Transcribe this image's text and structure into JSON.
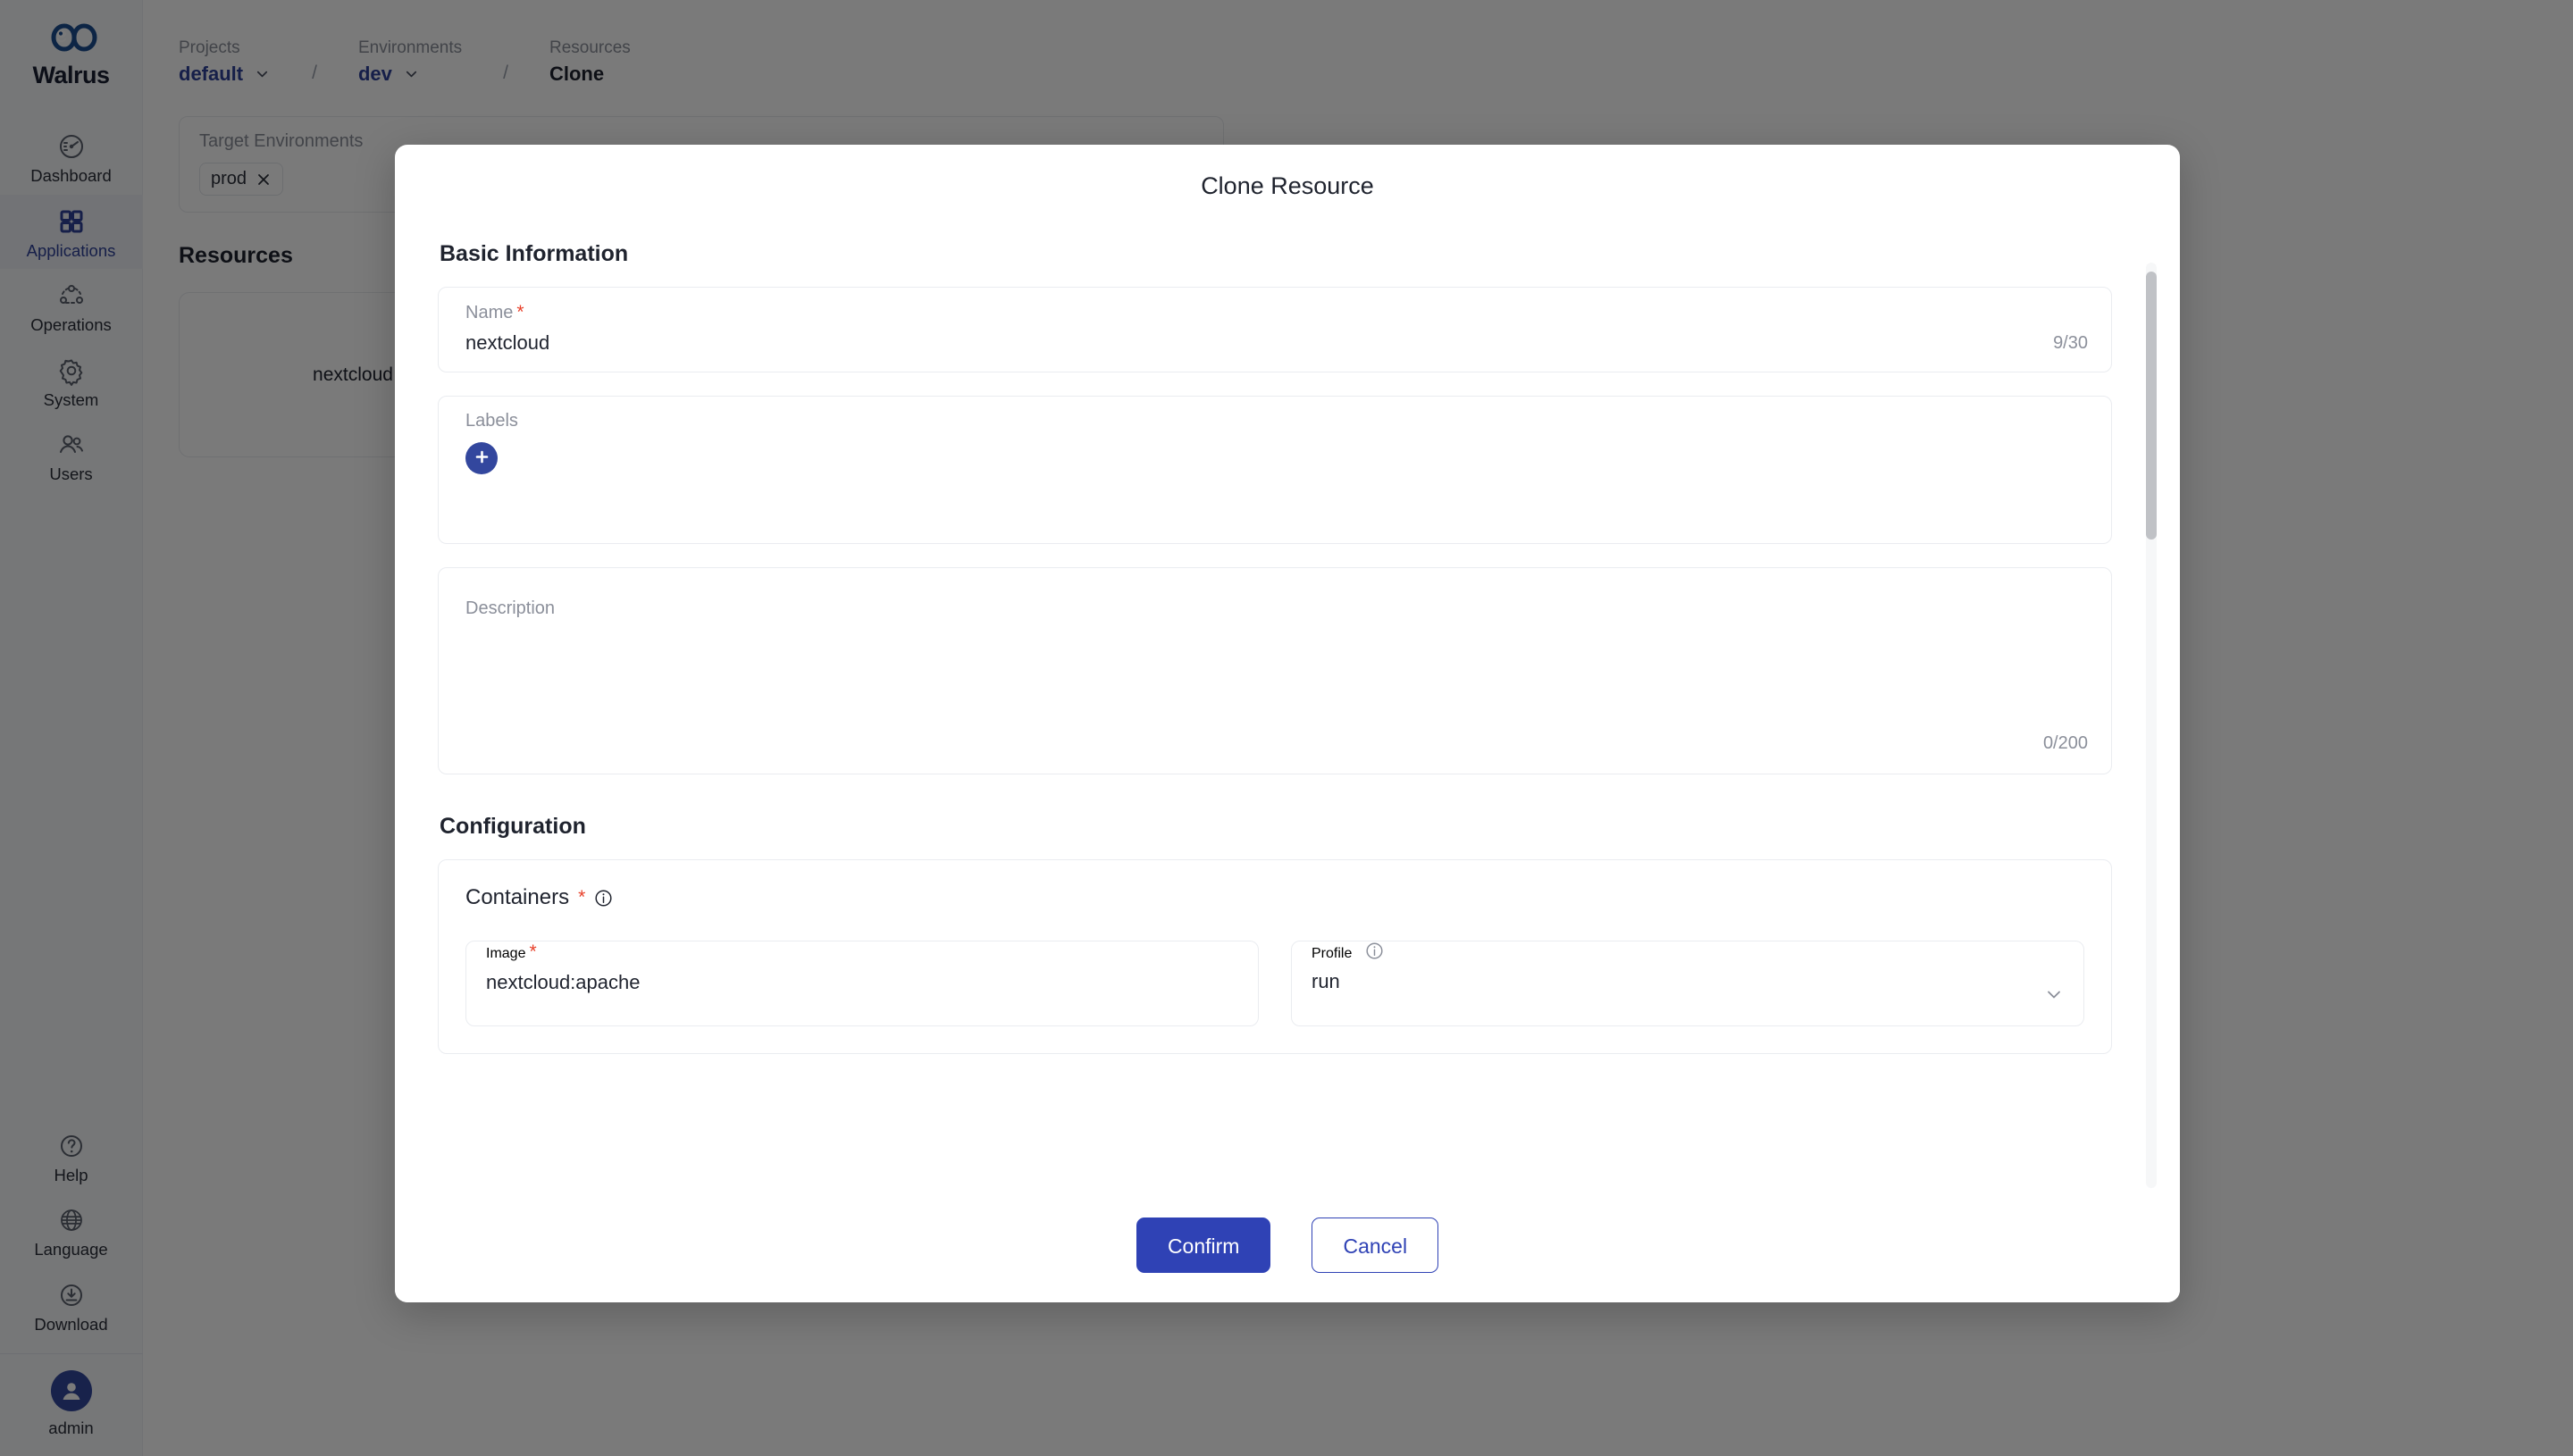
{
  "sidebar": {
    "brand": "Walrus",
    "items": [
      {
        "label": "Dashboard",
        "icon": "gauge-icon",
        "active": false
      },
      {
        "label": "Applications",
        "icon": "grid-icon",
        "active": true
      },
      {
        "label": "Operations",
        "icon": "topology-icon",
        "active": false
      },
      {
        "label": "System",
        "icon": "gear-icon",
        "active": false
      },
      {
        "label": "Users",
        "icon": "users-icon",
        "active": false
      }
    ],
    "bottom_items": [
      {
        "label": "Help",
        "icon": "question-circle-icon"
      },
      {
        "label": "Language",
        "icon": "globe-icon"
      },
      {
        "label": "Download",
        "icon": "download-circle-icon"
      }
    ],
    "user": {
      "name": "admin",
      "icon": "avatar-icon"
    },
    "accent_color": "#33479e",
    "active_text_color": "#2f4199"
  },
  "breadcrumb": {
    "items": [
      {
        "caption": "Projects",
        "value": "default",
        "has_dropdown": true
      },
      {
        "caption": "Environments",
        "value": "dev",
        "has_dropdown": true
      },
      {
        "caption": "Resources",
        "value": "Clone",
        "has_dropdown": false
      }
    ],
    "separator": "/"
  },
  "background_page": {
    "target_environments_label": "Target Environments",
    "target_environment_tags": [
      "prod"
    ],
    "resources_heading": "Resources",
    "resource_cards": [
      {
        "name": "nextcloud"
      }
    ]
  },
  "modal": {
    "title": "Clone Resource",
    "sections": {
      "basic": {
        "heading": "Basic Information",
        "name": {
          "label": "Name",
          "required": true,
          "value": "nextcloud",
          "counter": "9/30"
        },
        "labels": {
          "label": "Labels",
          "add_button_icon": "plus-icon"
        },
        "description": {
          "placeholder": "Description",
          "value": "",
          "counter": "0/200"
        }
      },
      "configuration": {
        "heading": "Configuration",
        "containers": {
          "label": "Containers",
          "required": true,
          "info_icon": "info-circle-icon",
          "fields": [
            {
              "label": "Image",
              "required": true,
              "value": "nextcloud:apache",
              "type": "text"
            },
            {
              "label": "Profile",
              "required": false,
              "info_icon": "info-circle-icon",
              "value": "run",
              "type": "select"
            }
          ]
        }
      }
    },
    "footer": {
      "confirm_label": "Confirm",
      "cancel_label": "Cancel",
      "confirm_color": "#2f42b5",
      "cancel_color": "#2f42b5"
    },
    "scrollbar": {
      "visible": true
    }
  }
}
